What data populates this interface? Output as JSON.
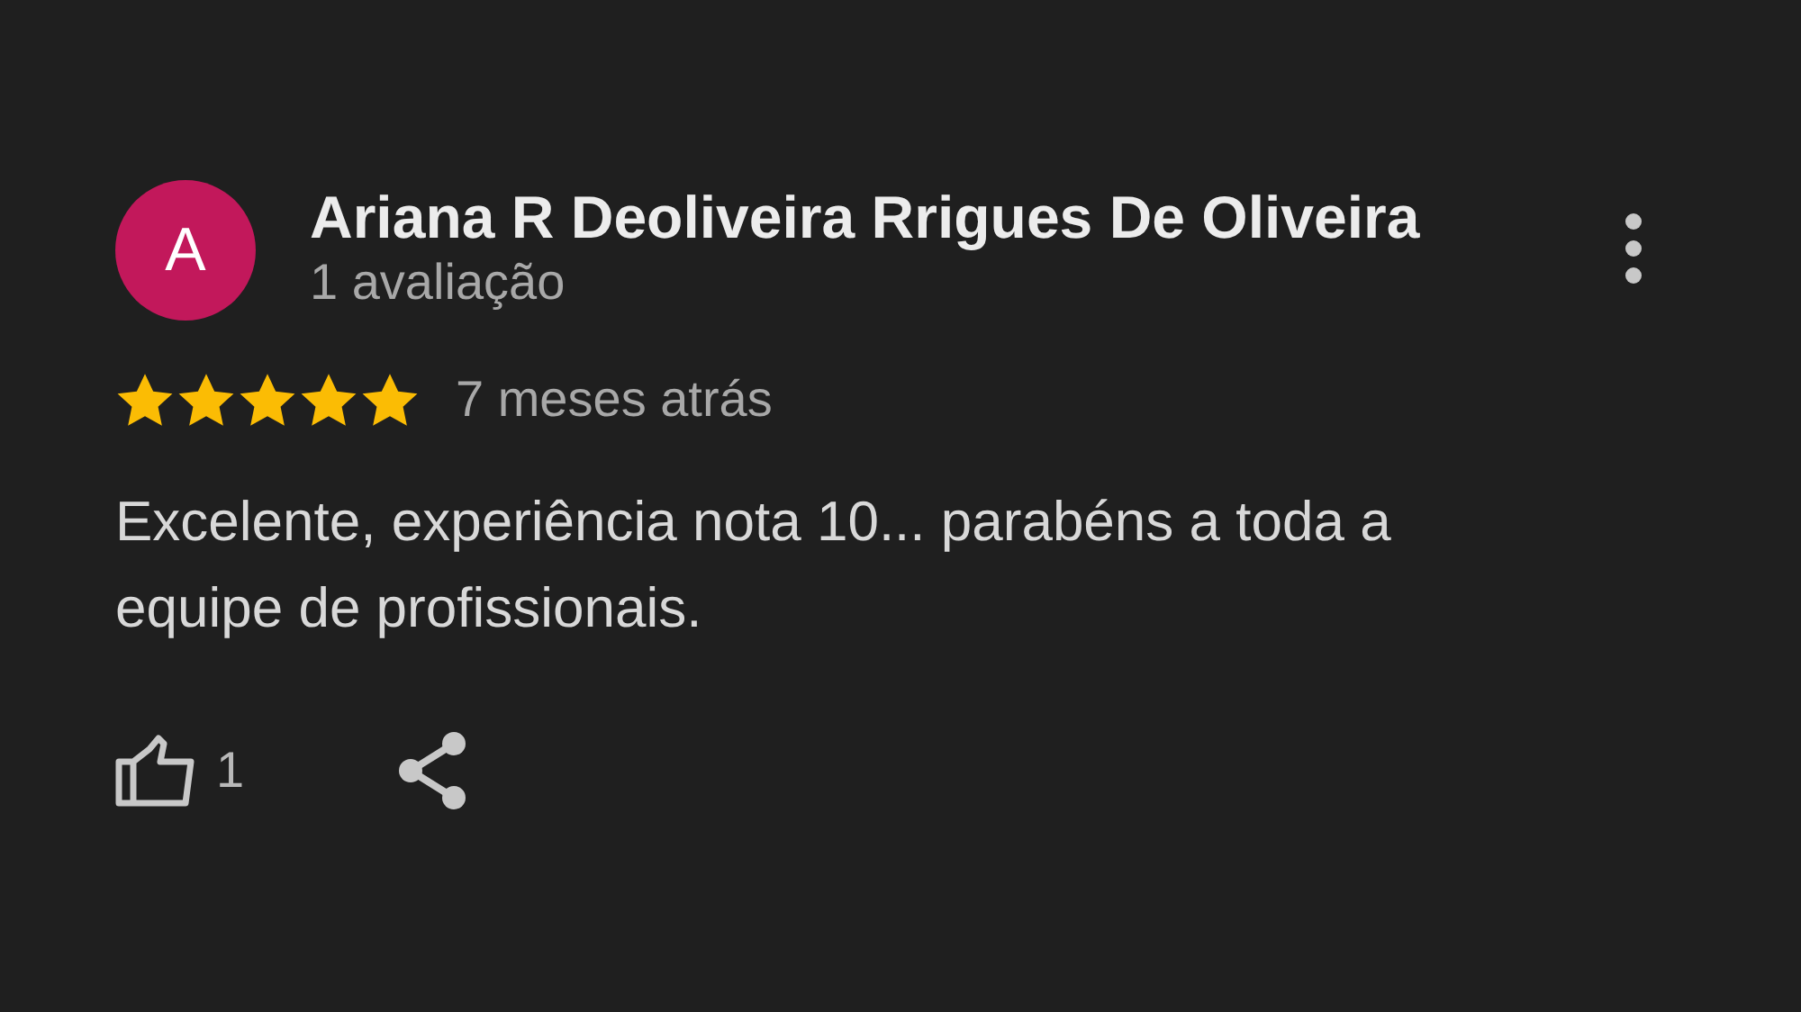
{
  "review": {
    "avatar_letter": "A",
    "author": "Ariana R Deoliveira Rrigues De Oliveira",
    "reviews_count": "1 avaliação",
    "stars": 5,
    "time": "7 meses atrás",
    "text": "Excelente, experiência nota 10... parabéns a toda a equipe de profissionais.",
    "likes": "1"
  }
}
